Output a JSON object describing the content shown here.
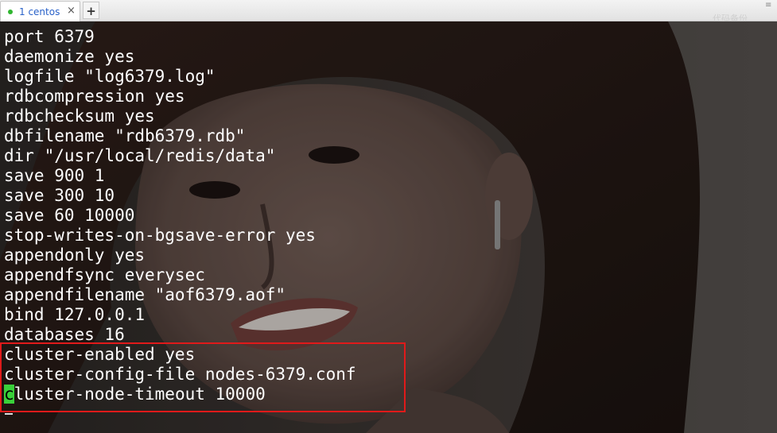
{
  "tabs": [
    {
      "label": "1 centos",
      "close_glyph": "×",
      "status_icon": "connected-dot-icon"
    }
  ],
  "new_tab_label": "+",
  "tabbar_right_label": "代码备份",
  "tabbar_chevron": "≡",
  "terminal": {
    "lines": [
      "port 6379",
      "daemonize yes",
      "logfile \"log6379.log\"",
      "rdbcompression yes",
      "rdbchecksum yes",
      "dbfilename \"rdb6379.rdb\"",
      "dir \"/usr/local/redis/data\"",
      "save 900 1",
      "save 300 10",
      "save 60 10000",
      "stop-writes-on-bgsave-error yes",
      "appendonly yes",
      "appendfsync everysec",
      "appendfilename \"aof6379.aof\"",
      "bind 127.0.0.1",
      "databases 16",
      "cluster-enabled yes",
      "cluster-config-file nodes-6379.conf"
    ],
    "cursor_line": {
      "cursor_char": "c",
      "rest": "luster-node-timeout 10000"
    }
  },
  "colors": {
    "text": "#ffffff",
    "cursor": "#3ad03a",
    "highlight_border": "#e01a1a",
    "tab_label": "#2a62c9",
    "status_dot": "#2fb52f"
  }
}
